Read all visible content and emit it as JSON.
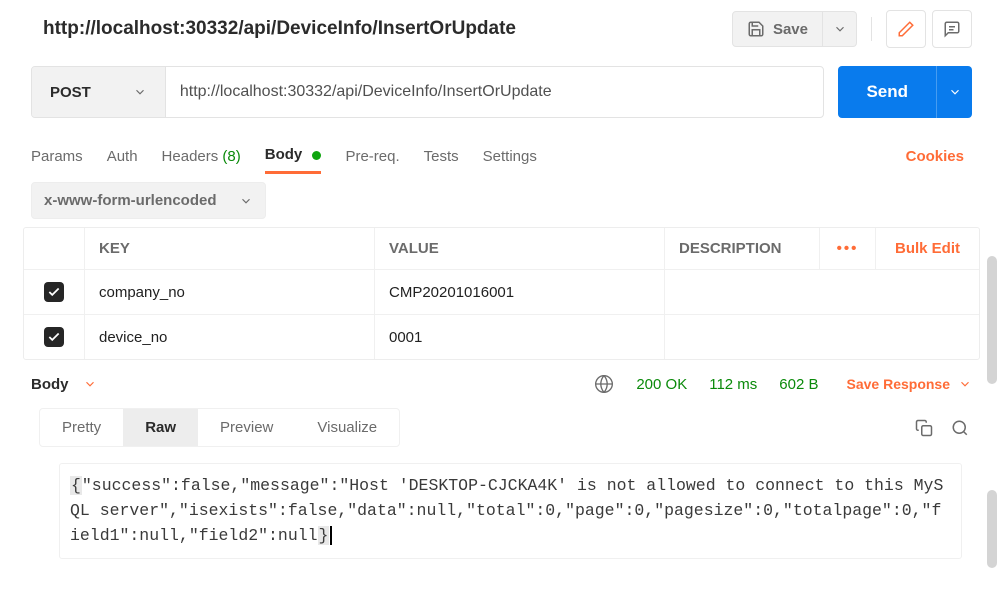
{
  "title": "http://localhost:30332/api/DeviceInfo/InsertOrUpdate",
  "toolbar": {
    "save_label": "Save"
  },
  "request": {
    "method": "POST",
    "url": "http://localhost:30332/api/DeviceInfo/InsertOrUpdate",
    "send_label": "Send"
  },
  "tabs": {
    "params": "Params",
    "auth": "Auth",
    "headers_label": "Headers",
    "headers_count": "(8)",
    "body": "Body",
    "pre": "Pre-req.",
    "tests": "Tests",
    "settings": "Settings",
    "cookies": "Cookies"
  },
  "body_type": "x-www-form-urlencoded",
  "grid": {
    "key_header": "KEY",
    "value_header": "VALUE",
    "desc_header": "DESCRIPTION",
    "bulk": "Bulk Edit",
    "rows": [
      {
        "key": "company_no",
        "value": "CMP20201016001"
      },
      {
        "key": "device_no",
        "value": "0001"
      }
    ]
  },
  "response": {
    "label": "Body",
    "status": "200 OK",
    "time": "112 ms",
    "size": "602 B",
    "save_label": "Save Response",
    "tabs": {
      "pretty": "Pretty",
      "raw": "Raw",
      "preview": "Preview",
      "visualize": "Visualize"
    },
    "raw": "\"success\":false,\"message\":\"Host 'DESKTOP-CJCKA4K' is not allowed to connect to this MySQL server\",\"isexists\":false,\"data\":null,\"total\":0,\"page\":0,\"pagesize\":0,\"totalpage\":0,\"field1\":null,\"field2\":null"
  }
}
